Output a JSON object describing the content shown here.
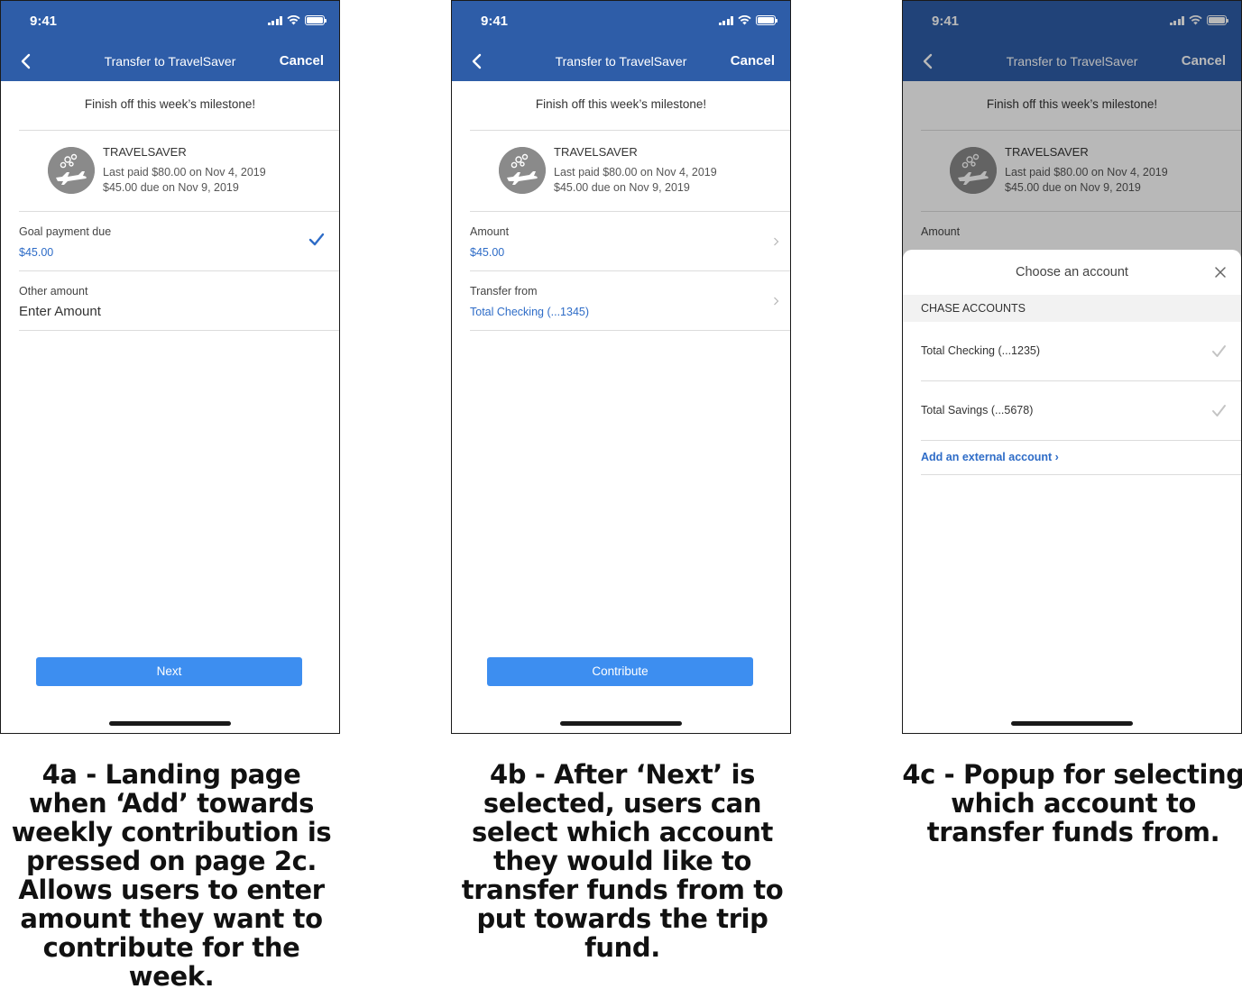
{
  "status": {
    "time": "9:41"
  },
  "nav": {
    "title": "Transfer to TravelSaver",
    "cancel": "Cancel"
  },
  "milestone": "Finish off this week’s milestone!",
  "account": {
    "name": "TRAVELSAVER",
    "last_paid": "Last paid $80.00 on Nov 4, 2019",
    "due": "$45.00 due on Nov 9, 2019",
    "icon": "plane-with-coins-icon"
  },
  "screen_a": {
    "goal_label": "Goal payment due",
    "goal_value": "$45.00",
    "other_label": "Other amount",
    "other_placeholder": "Enter Amount",
    "button": "Next"
  },
  "screen_b": {
    "amount_label": "Amount",
    "amount_value": "$45.00",
    "from_label": "Transfer from",
    "from_value": "Total Checking (...1345)",
    "button": "Contribute"
  },
  "screen_c": {
    "amount_label": "Amount",
    "sheet_title": "Choose an account",
    "section": "CHASE ACCOUNTS",
    "options": [
      "Total Checking (...1235)",
      "Total Savings (...5678)"
    ],
    "add_external": "Add an external account ›"
  },
  "captions": [
    "4a - Landing page when ‘Add’ towards weekly contribution is pressed on page 2c. Allows users to enter amount they want to contribute for the week.",
    "4b - After ‘Next’ is selected, users can select which account they would like to transfer funds from to put towards the trip fund.",
    "4c - Popup for selecting which account to transfer funds from."
  ],
  "colors": {
    "header": "#2e5da8",
    "accent": "#3d8ef0",
    "link": "#2e6cc7"
  }
}
